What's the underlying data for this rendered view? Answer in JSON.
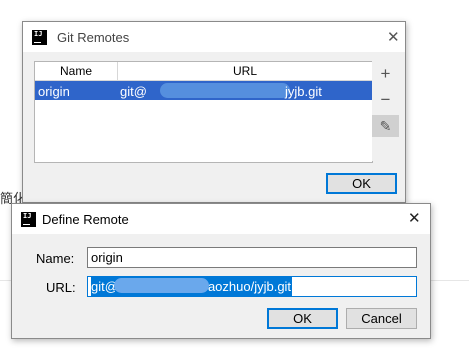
{
  "background": {
    "fragment_text": "簡化"
  },
  "git_remotes": {
    "title": "Git Remotes",
    "columns": [
      "Name",
      "URL"
    ],
    "rows": [
      {
        "name": "origin",
        "url_start": "git@",
        "url_end": "jyjb.git",
        "selected": true
      }
    ],
    "side_buttons": {
      "add": "+",
      "remove": "−",
      "edit": "✎"
    },
    "ok_label": "OK"
  },
  "define_remote": {
    "title": "Define Remote",
    "name_label": "Name:",
    "name_value": "origin",
    "url_label": "URL:",
    "url_start": "git@",
    "url_end": "aozhuo/jyjb.git",
    "ok_label": "OK",
    "cancel_label": "Cancel"
  },
  "colors": {
    "selection": "#2f65ca",
    "focus": "#0078d7",
    "window_bg": "#f0f0f0"
  },
  "icons": {
    "app": "intellij-idea-icon",
    "close": "close-icon"
  }
}
